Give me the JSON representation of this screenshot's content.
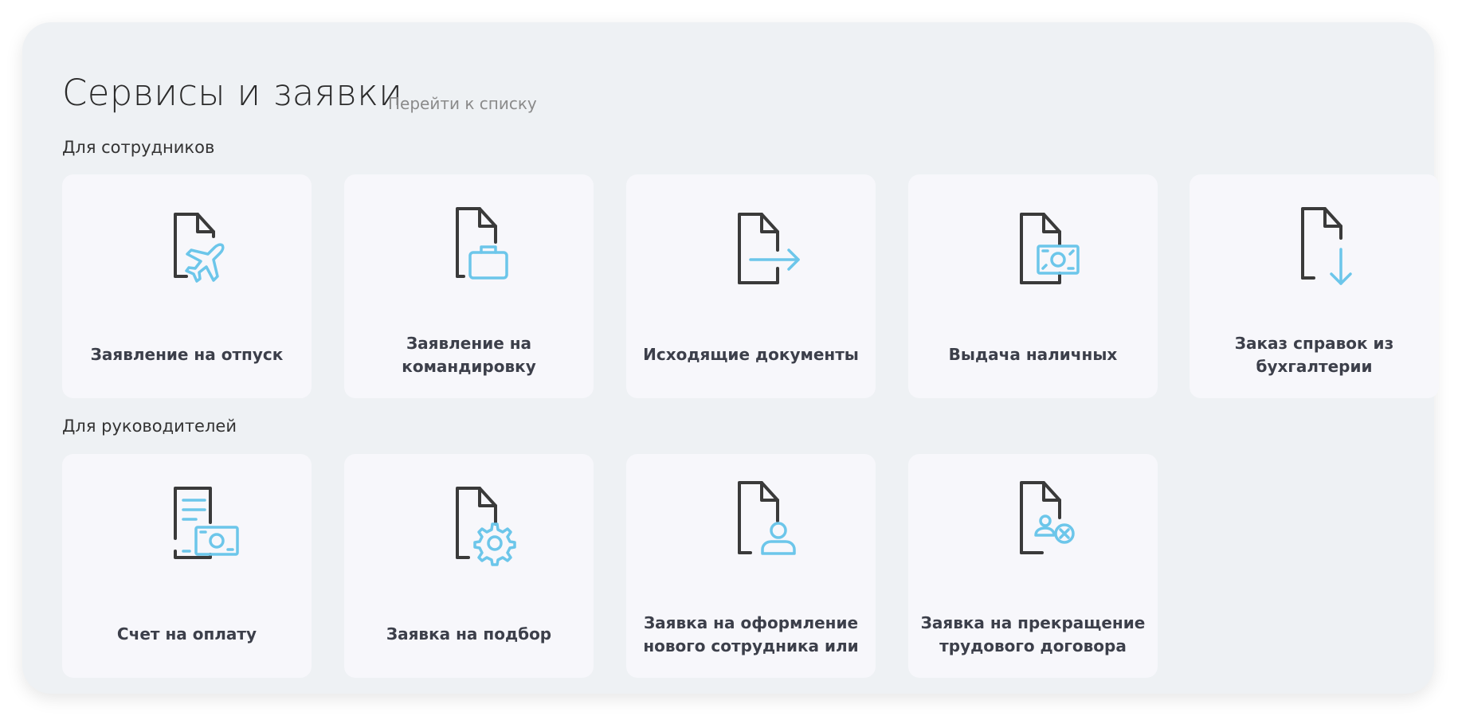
{
  "header": {
    "title": "Сервисы и заявки",
    "link": "Перейти к списку"
  },
  "sections": [
    {
      "title": "Для сотрудников",
      "cards": [
        {
          "label": "Заявление на отпуск",
          "icon": "document-airplane-icon"
        },
        {
          "label": "Заявление на командировку",
          "icon": "document-briefcase-icon"
        },
        {
          "label": "Исходящие документы",
          "icon": "document-arrow-right-icon"
        },
        {
          "label": "Выдача наличных",
          "icon": "document-cash-icon"
        },
        {
          "label": "Заказ справок из бухгалтерии",
          "icon": "document-arrow-down-icon"
        }
      ]
    },
    {
      "title": "Для руководителей",
      "cards": [
        {
          "label": "Счет на оплату",
          "icon": "invoice-cash-icon"
        },
        {
          "label": "Заявка на подбор",
          "icon": "document-gear-icon"
        },
        {
          "label": "Заявка на оформление нового сотрудника или",
          "icon": "document-person-icon"
        },
        {
          "label": "Заявка на прекращение трудового договора",
          "icon": "document-person-remove-icon"
        }
      ]
    }
  ],
  "colors": {
    "panel_bg": "#eef1f4",
    "card_bg": "#f7f7fb",
    "icon_dark": "#3a3a3a",
    "icon_accent": "#6cc6ea",
    "label_text": "#3c3f4a"
  }
}
